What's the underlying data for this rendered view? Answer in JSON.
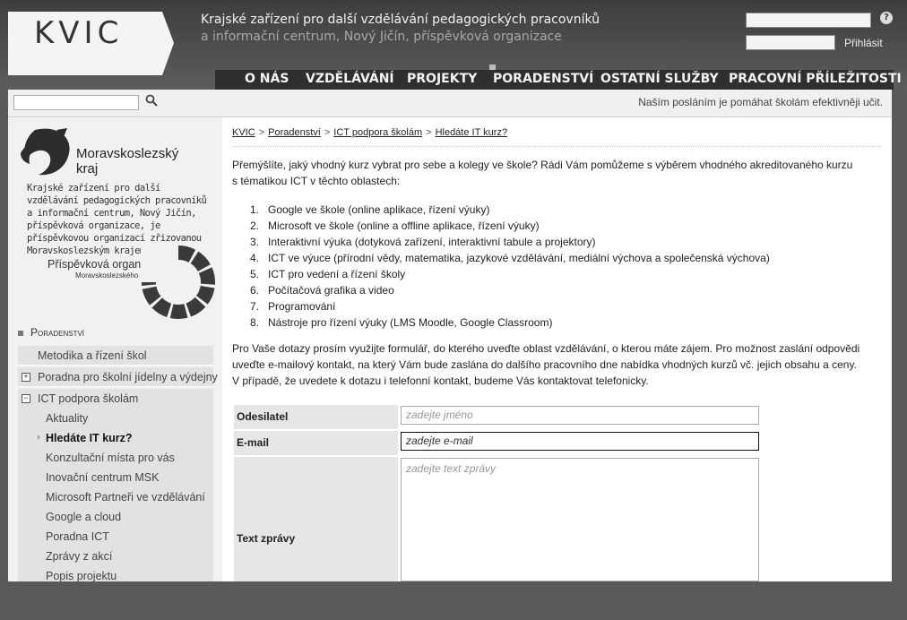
{
  "header": {
    "logo_text": "KVIC",
    "org_title": "Krajské zařízení pro další vzdělávání pedagogických pracovníků",
    "org_subtitle": "a informační centrum, Nový Jičín, příspěvková organizace",
    "login_button": "Přihlásit",
    "help_label": "?"
  },
  "nav": {
    "items": [
      "O NÁS",
      "VZDĚLÁVÁNÍ",
      "PROJEKTY",
      "PORADENSTVÍ",
      "OSTATNÍ SLUŽBY",
      "PRACOVNÍ PŘÍLEŽITOSTI"
    ]
  },
  "subheader": {
    "mission": "Naším posláním je pomáhat školám efektivněji učit."
  },
  "sidebar": {
    "region_name_1": "Moravskoslezský",
    "region_name_2": "kraj",
    "org_description": "Krajské zařízení pro další vzdělávání pedagogických pracovníků a informační centrum, Nový Jičín, příspěvková organizace, je příspěvkovou organizací zřizovanou Moravskoslezským krajem",
    "contrib_title": "Příspěvková organizace",
    "contrib_sub": "Moravskoslezského kraje",
    "section_title": "Poradenství",
    "menu": [
      {
        "label": "Metodika a řízení škol",
        "toggle": ""
      },
      {
        "label": "Poradna pro školní jídelny a výdejny",
        "toggle": "+"
      },
      {
        "label": "ICT podpora školám",
        "toggle": "−"
      }
    ],
    "submenu": [
      "Aktuality",
      "Hledáte IT kurz?",
      "Konzultační místa pro vás",
      "Inovační centrum MSK",
      "Microsoft Partneři ve vzdělávání",
      "Google a cloud",
      "Poradna ICT",
      "Zprávy z akcí",
      "Popis projektu"
    ]
  },
  "breadcrumb": {
    "items": [
      "KVIC",
      "Poradenství",
      "ICT podpora školám",
      "Hledáte IT kurz?"
    ],
    "separator": ">"
  },
  "main": {
    "intro_1": "Přemýšlíte, jaký vhodný kurz vybrat pro sebe a kolegy ve škole? Rádi Vám pomůžeme s výběrem vhodného akreditovaného kurzu",
    "intro_2": "s tématikou ICT v těchto oblastech:",
    "topics": [
      "Google ve škole (online aplikace, řízení výuky)",
      "Microsoft ve škole (online a offline aplikace, řízení výuky)",
      "Interaktivní výuka (dotyková zařízení, interaktivní tabule a projektory)",
      "ICT ve výuce (přírodní vědy, matematika, jazykové vzdělávání, mediální výchova a společenská výchova)",
      "ICT pro vedení a řízení školy",
      "Počítačová grafika a video",
      "Programování",
      "Nástroje pro řízení výuky (LMS Moodle, Google Classroom)"
    ],
    "contact_1": "Pro Vaše dotazy prosím využijte formulář, do kterého uveďte oblast vzdělávání, o kterou máte zájem. Pro možnost zaslání odpovědi",
    "contact_2": "uveďte e-mailový kontakt, na který Vám bude zaslána do dalšího pracovního dne nabídka vhodných kurzů vč. jejich obsahu a ceny.",
    "contact_3": "V případě, že uvedete k dotazu i telefonní kontakt, budeme Vás kontaktovat telefonicky."
  },
  "form": {
    "sender_label": "Odesilatel",
    "sender_placeholder": "zadejte jméno",
    "email_label": "E-mail",
    "email_placeholder": "zadejte e-mail",
    "message_label": "Text zprávy",
    "message_placeholder": "zadejte text zprávy"
  }
}
